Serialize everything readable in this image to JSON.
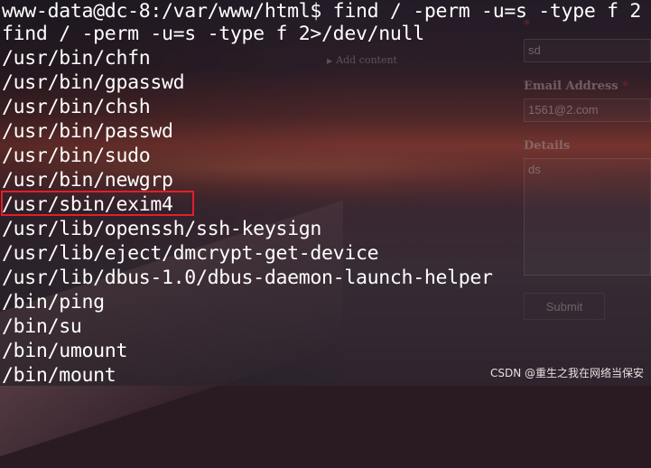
{
  "terminal": {
    "prompt_line": "www-data@dc-8:/var/www/html$ find / -perm -u=s -type f 2",
    "command_echo": "find / -perm -u=s -type f 2>/dev/null",
    "results": [
      "/usr/bin/chfn",
      "/usr/bin/gpasswd",
      "/usr/bin/chsh",
      "/usr/bin/passwd",
      "/usr/bin/sudo",
      "/usr/bin/newgrp",
      "/usr/sbin/exim4",
      "/usr/lib/openssh/ssh-keysign",
      "/usr/lib/eject/dmcrypt-get-device",
      "/usr/lib/dbus-1.0/dbus-daemon-launch-helper",
      "/bin/ping",
      "/bin/su",
      "/bin/umount",
      "/bin/mount"
    ],
    "highlighted_result": "/usr/sbin/exim4",
    "highlight_color": "#e0202a"
  },
  "background_form": {
    "add_content": "Add content",
    "name_value": "sd",
    "email_label": "Email Address",
    "email_value": "1561@2.com",
    "details_label": "Details",
    "details_value": "ds",
    "required_mark": "*",
    "submit_label": "Submit"
  },
  "watermark": "CSDN @重生之我在网络当保安"
}
